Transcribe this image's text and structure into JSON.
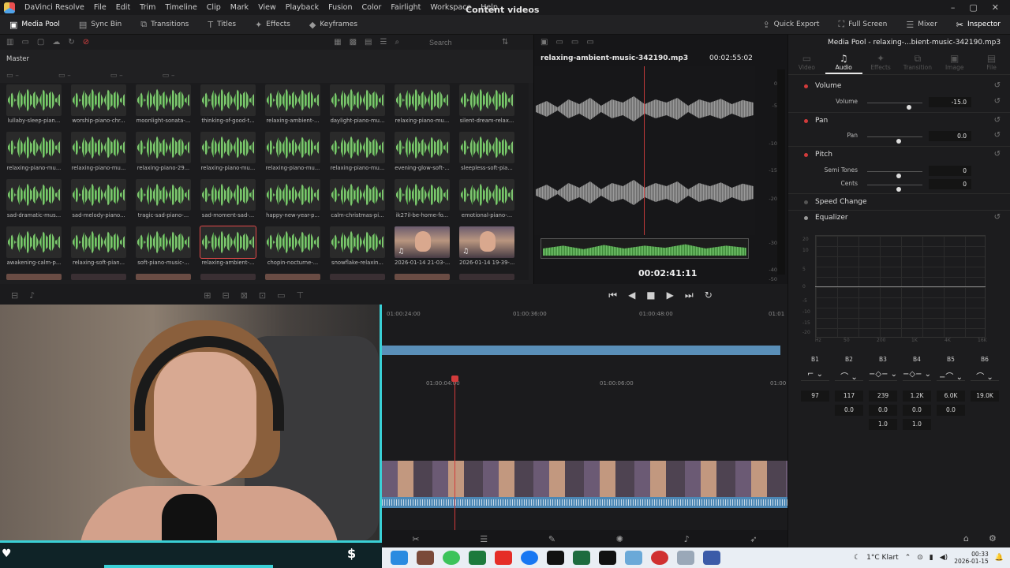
{
  "app": {
    "title": "DaVinci Resolve",
    "menu": [
      "File",
      "Edit",
      "Trim",
      "Timeline",
      "Clip",
      "Mark",
      "View",
      "Playback",
      "Fusion",
      "Color",
      "Fairlight",
      "Workspace",
      "Help"
    ],
    "project_title": "Content videos"
  },
  "toolbar": {
    "left": [
      "Media Pool",
      "Sync Bin",
      "Transitions",
      "Titles",
      "Effects",
      "Keyframes"
    ],
    "right": [
      "Quick Export",
      "Full Screen",
      "Mixer",
      "Inspector"
    ]
  },
  "media_pool": {
    "search_placeholder": "Search",
    "bin": "Master",
    "clips": [
      "lullaby-sleep-pian...",
      "worship-piano-chr...",
      "moonlight-sonata-...",
      "thinking-of-good-t...",
      "relaxing-ambient-...",
      "daylight-piano-mu...",
      "relaxing-piano-mu...",
      "silent-dream-relax...",
      "relaxing-piano-mu...",
      "relaxing-piano-mu...",
      "relaxing-piano-29...",
      "relaxing-piano-mu...",
      "relaxing-piano-mu...",
      "relaxing-piano-mu...",
      "evening-glow-soft-...",
      "sleepless-soft-pia...",
      "sad-dramatic-mus...",
      "sad-melody-piano...",
      "tragic-sad-piano-...",
      "sad-moment-sad-...",
      "happy-new-year-p...",
      "calm-christmas-pi...",
      "ik27il-be-home-fo...",
      "emotional-piano-...",
      "awakening-calm-p...",
      "relaxing-soft-pian...",
      "soft-piano-music-...",
      "relaxing-ambient-...",
      "chopin-nocturne-...",
      "snowflake-relaxin...",
      "2026-01-14 21-03-...",
      "2026-01-14 19-39-..."
    ]
  },
  "viewer": {
    "clip_name": "relaxing-ambient-music-342190.mp3",
    "duration": "00:02:55:02",
    "timecode": "00:02:41:11",
    "db_scale": [
      "0",
      "-5",
      "-10",
      "-15",
      "-20",
      "-30",
      "-40",
      "-50"
    ]
  },
  "timeline": {
    "ruler_top": [
      "01:00:24:00",
      "01:00:36:00",
      "01:00:48:00",
      "01:01"
    ],
    "ruler_bottom": [
      "01:00:04:00",
      "01:00:06:00",
      "01:00"
    ]
  },
  "inspector": {
    "title": "Media Pool - relaxing-...bient-music-342190.mp3",
    "tabs": [
      "Video",
      "Audio",
      "Effects",
      "Transition",
      "Image",
      "File"
    ],
    "active_tab": "Audio",
    "volume": {
      "header": "Volume",
      "label": "Volume",
      "value": "-15.0"
    },
    "pan": {
      "header": "Pan",
      "label": "Pan",
      "value": "0.0"
    },
    "pitch": {
      "header": "Pitch",
      "semi_label": "Semi Tones",
      "semi_value": "0",
      "cents_label": "Cents",
      "cents_value": "0"
    },
    "speed_change": "Speed Change",
    "equalizer": "Equalizer",
    "eq_y": [
      "20",
      "10",
      "5",
      "0",
      "-5",
      "-10",
      "-15",
      "-20"
    ],
    "eq_x": [
      "Hz",
      "50",
      "200",
      "1K",
      "4K",
      "16K"
    ],
    "bands": [
      {
        "name": "B1",
        "freq": "97",
        "gain": "",
        "q": ""
      },
      {
        "name": "B2",
        "freq": "117",
        "gain": "0.0",
        "q": ""
      },
      {
        "name": "B3",
        "freq": "239",
        "gain": "0.0",
        "q": "1.0"
      },
      {
        "name": "B4",
        "freq": "1.2K",
        "gain": "0.0",
        "q": "1.0"
      },
      {
        "name": "B5",
        "freq": "6.0K",
        "gain": "0.0",
        "q": ""
      },
      {
        "name": "B6",
        "freq": "19.0K",
        "gain": "",
        "q": ""
      }
    ]
  },
  "taskbar": {
    "weather": "1°C  Klart",
    "time": "00:33",
    "date": "2026-01-15"
  }
}
